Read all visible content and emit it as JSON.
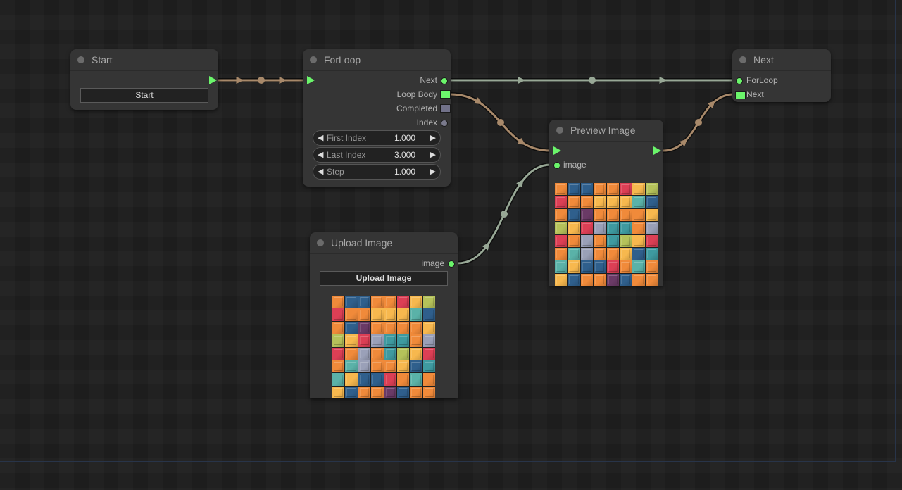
{
  "colors": {
    "exec_link": "#a8896a",
    "data_link": "#98a896",
    "slot_active": "#6bf56b",
    "slot_inactive": "#72728a"
  },
  "nodes": {
    "start": {
      "title": "Start",
      "button_label": "Start"
    },
    "forloop": {
      "title": "ForLoop",
      "outputs": [
        "Next",
        "Loop Body",
        "Completed",
        "Index"
      ],
      "widgets": [
        {
          "label": "First Index",
          "value": "1.000"
        },
        {
          "label": "Last Index",
          "value": "3.000"
        },
        {
          "label": "Step",
          "value": "1.000"
        }
      ]
    },
    "next": {
      "title": "Next",
      "inputs": [
        "ForLoop",
        "Next"
      ]
    },
    "preview": {
      "title": "Preview Image",
      "inputs": [
        "image"
      ]
    },
    "upload": {
      "title": "Upload Image",
      "outputs": [
        "image"
      ],
      "button_label": "Upload Image"
    }
  },
  "mosaic_palette": {
    "o": "#f08a3a",
    "y": "#f7b84e",
    "b": "#2f5f8c",
    "t": "#3e9aa0",
    "r": "#dc3f55",
    "g": "#b5c25a",
    "p": "#6a3a66",
    "l": "#9aa0b8",
    "c": "#5ab2a8"
  },
  "mosaic_rows": [
    "obbooryg",
    "rooyyycb",
    "obpooooy",
    "gyrlttol",
    "rolotgyr",
    "oclooybt",
    "cybbroco",
    "yboopboo"
  ]
}
